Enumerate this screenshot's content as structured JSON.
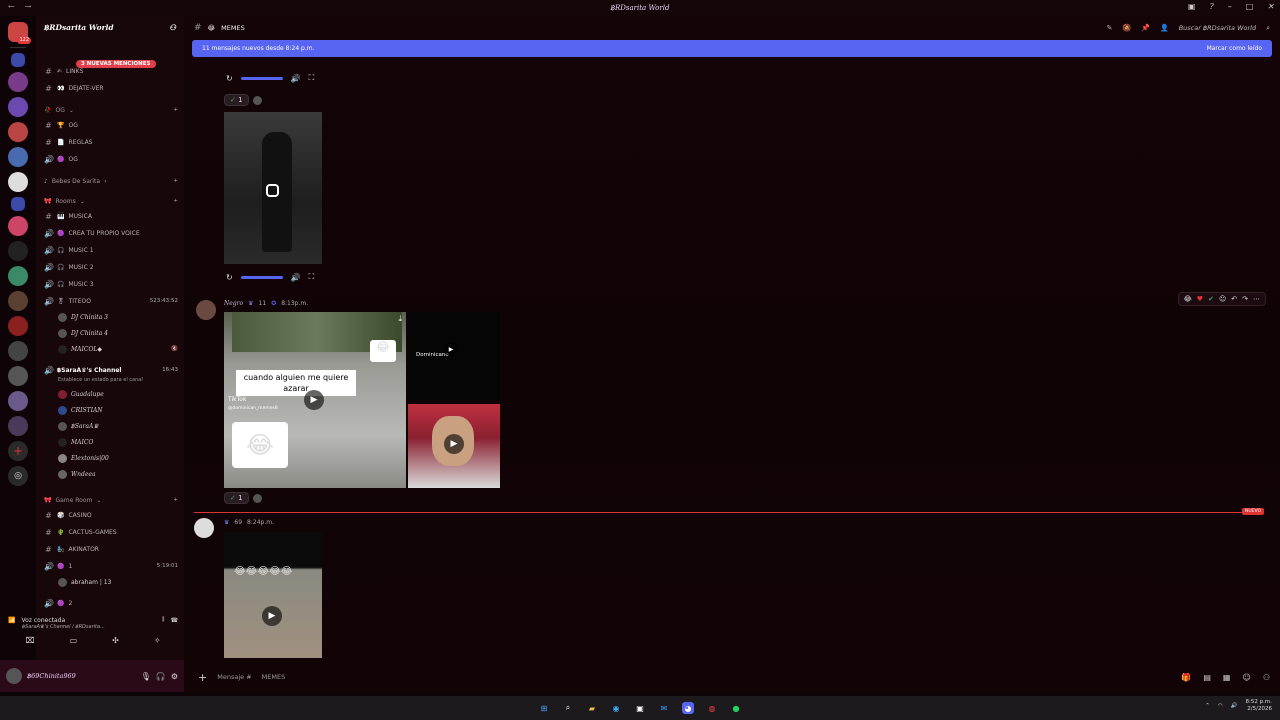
{
  "window": {
    "title": "฿RDsarita World"
  },
  "server": {
    "name": "฿RDsarita World",
    "mentions_label": "3 NUEVAS MENCIONES",
    "home_badge": "122"
  },
  "channels": {
    "links": "LINKS",
    "dejate_ver": "DEJATE-VER",
    "cat_og": "OG",
    "og1": "OG",
    "reglas": "REGLAS",
    "og2": "OG",
    "cat_bebes": "Bebes De Sarita",
    "cat_rooms": "Rooms",
    "musica": "MUSICA",
    "crea": "CREA TU PROPIO VOICE",
    "music1": "MUSIC 1",
    "music2": "MUSIC 2",
    "music3": "MUSIC 3",
    "titeo": "TITEOO",
    "titeo_time": "523:43:52",
    "users_titeo": [
      "DJ Chinita 3",
      "DJ Chinita 4",
      "MAICOL◆"
    ],
    "sara_channel": "฿SaraA♛'s Channel",
    "sara_time": "16:43",
    "sara_status": "Establece un estado para el canal",
    "users_sara": [
      "Guadalupe",
      "CRISTIAN",
      "฿SaraA♛",
      "MAICO",
      "Elextonis|00",
      "Wndeea"
    ],
    "cat_game": "Game Room",
    "casino": "CASINO",
    "cactus": "CACTUS-GAMES",
    "akinator": "AKINATOR",
    "ch1": "1",
    "ch1_time": "5:19:01",
    "user_ch1": "abraham | 13",
    "ch2": "2"
  },
  "voice": {
    "status": "Voz conectada",
    "channel": "฿SaraA♛'s Channel / ฿RDsarita..."
  },
  "user": {
    "name": "฿69Chinita969"
  },
  "header": {
    "channel": "MEMES",
    "search": "Buscar ฿RDsarita World"
  },
  "newbar": {
    "text": "11 mensajes nuevos desde 8:24 p.m.",
    "mark": "Marcar como leído"
  },
  "messages": [
    {
      "reaction_count": "1"
    },
    {
      "author": "Negro",
      "level": "11",
      "time": "8:13p.m.",
      "caption": "cuando alguien me quiere azarar",
      "tiktok": "TikTok",
      "handle": "@dominican_memes8",
      "thumb_text": "Dominicano",
      "reaction_count": "1"
    },
    {
      "time": "8:24p.m.",
      "level": "69"
    }
  ],
  "divider": {
    "label": "NUEVO"
  },
  "composer": {
    "placeholder": "Mensaje #",
    "channel": "MEMES"
  },
  "taskbar": {
    "time": "8:52 p.m.",
    "date": "2/5/2026"
  },
  "colors": {
    "accent": "#5865f2",
    "new": "#dd3333"
  }
}
